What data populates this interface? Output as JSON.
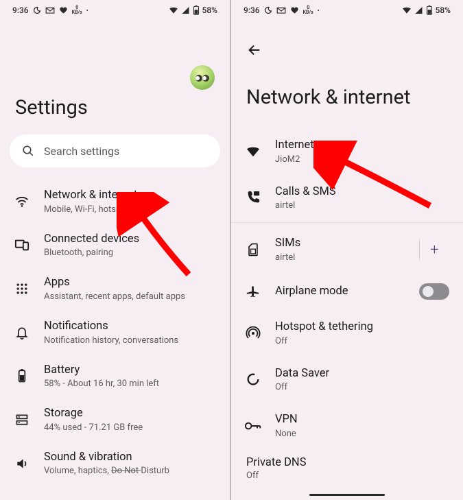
{
  "status": {
    "time": "9:36",
    "kbs_num": "0",
    "kbs_unit": "KB/s",
    "battery": "58%"
  },
  "left": {
    "title": "Settings",
    "search_placeholder": "Search settings",
    "items": [
      {
        "title": "Network & internet",
        "sub": "Mobile, Wi-Fi, hotspot"
      },
      {
        "title": "Connected devices",
        "sub": "Bluetooth, pairing"
      },
      {
        "title": "Apps",
        "sub": "Assistant, recent apps, default apps"
      },
      {
        "title": "Notifications",
        "sub": "Notification history, conversations"
      },
      {
        "title": "Battery",
        "sub": "58% - About 16 hr, 30 min left"
      },
      {
        "title": "Storage",
        "sub": "44% used - 71.21 GB free"
      },
      {
        "title": "Sound & vibration",
        "sub_prefix": "Volume, haptics, ",
        "sub_strike": "Do Not ",
        "sub_suffix": "Disturb"
      }
    ]
  },
  "right": {
    "title": "Network & internet",
    "items_top": [
      {
        "title": "Internet",
        "sub": "JioM2"
      },
      {
        "title": "Calls & SMS",
        "sub": "airtel"
      }
    ],
    "items_block": [
      {
        "title": "SIMs",
        "sub": "airtel"
      },
      {
        "title": "Airplane mode",
        "sub": ""
      },
      {
        "title": "Hotspot & tethering",
        "sub": "Off"
      },
      {
        "title": "Data Saver",
        "sub": "Off"
      },
      {
        "title": "VPN",
        "sub": "None"
      }
    ],
    "private_dns": {
      "title": "Private DNS",
      "sub": "Off"
    },
    "add_label": "+"
  }
}
